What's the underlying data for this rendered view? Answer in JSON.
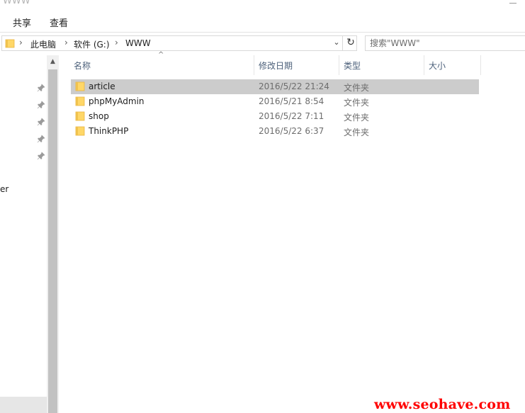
{
  "window": {
    "title": "WWW"
  },
  "ribbon": {
    "tabs": [
      {
        "label": "共享"
      },
      {
        "label": "查看"
      }
    ]
  },
  "address": {
    "crumbs": [
      {
        "label": "此电脑"
      },
      {
        "label": "软件 (G:)"
      },
      {
        "label": "WWW"
      }
    ],
    "separator": "›",
    "dropdown_glyph": "⌄",
    "refresh_glyph": "↻"
  },
  "search": {
    "placeholder": "搜索\"WWW\""
  },
  "nav": {
    "pinned_count": 5,
    "truncated_item": "er"
  },
  "columns": [
    {
      "label": "名称"
    },
    {
      "label": "修改日期"
    },
    {
      "label": "类型"
    },
    {
      "label": "大小"
    }
  ],
  "sort_indicator": "^",
  "files": [
    {
      "name": "article",
      "modified": "2016/5/22 21:24",
      "type": "文件夹",
      "selected": true
    },
    {
      "name": "phpMyAdmin",
      "modified": "2016/5/21 8:54",
      "type": "文件夹",
      "selected": false
    },
    {
      "name": "shop",
      "modified": "2016/5/22 7:11",
      "type": "文件夹",
      "selected": false
    },
    {
      "name": "ThinkPHP",
      "modified": "2016/5/22 6:37",
      "type": "文件夹",
      "selected": false
    }
  ],
  "watermark": "www.seohave.com",
  "colors": {
    "folder": "#ffd767",
    "folder_dark": "#e8b440",
    "selection": "#cccccc",
    "watermark": "#ff0000",
    "column_header": "#4c607a"
  }
}
